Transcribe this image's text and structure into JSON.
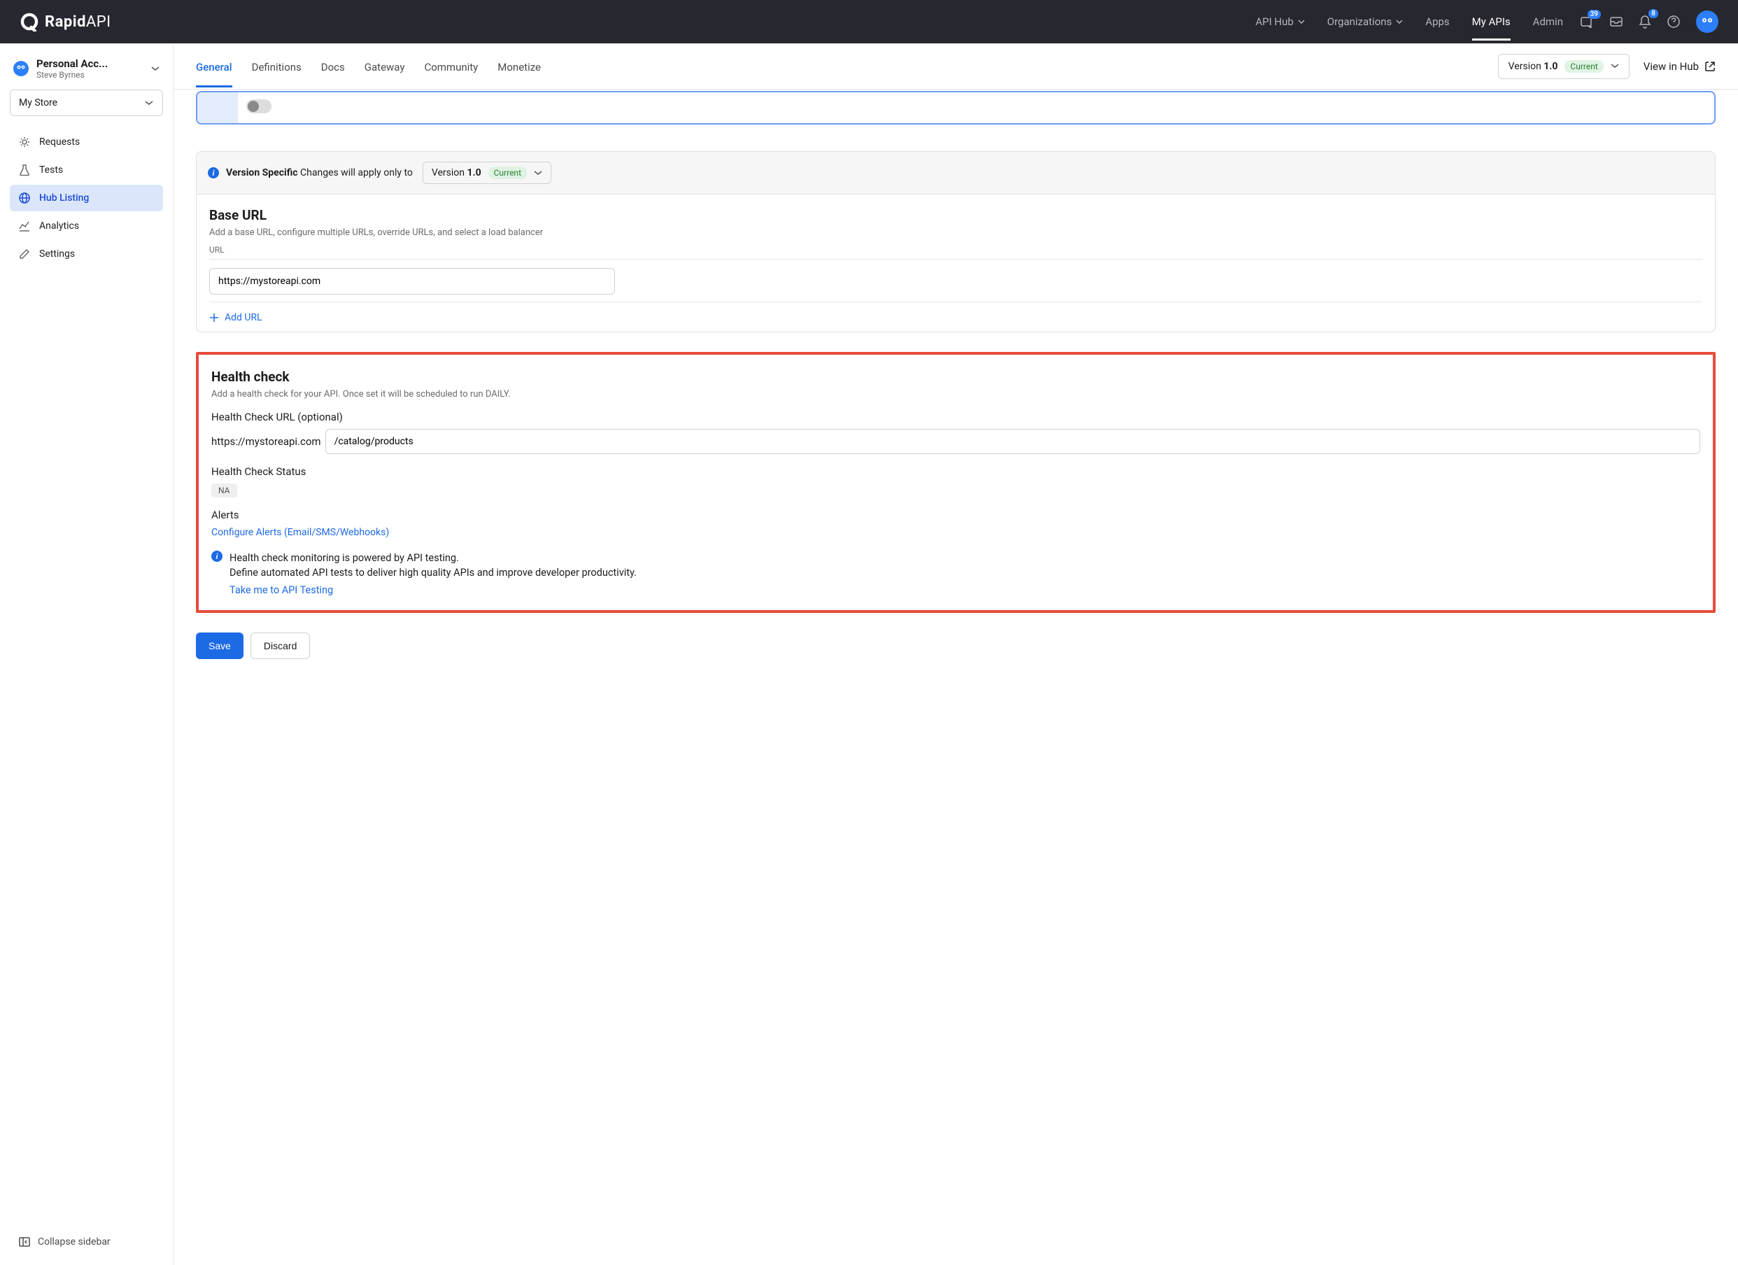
{
  "brand": {
    "name": "Rapid",
    "suffix": "API"
  },
  "topnav": {
    "items": [
      {
        "label": "API Hub",
        "caret": true
      },
      {
        "label": "Organizations",
        "caret": true
      },
      {
        "label": "Apps"
      },
      {
        "label": "My APIs",
        "active": true
      },
      {
        "label": "Admin"
      }
    ],
    "badge1": "39",
    "badge2": "8"
  },
  "account": {
    "title": "Personal Acc...",
    "subtitle": "Steve Byrnes"
  },
  "store_selector": "My Store",
  "sidebar": {
    "items": [
      {
        "label": "Requests"
      },
      {
        "label": "Tests"
      },
      {
        "label": "Hub Listing",
        "active": true
      },
      {
        "label": "Analytics"
      },
      {
        "label": "Settings"
      }
    ]
  },
  "collapse_label": "Collapse sidebar",
  "tabs": {
    "items": [
      {
        "label": "General",
        "active": true
      },
      {
        "label": "Definitions"
      },
      {
        "label": "Docs"
      },
      {
        "label": "Gateway"
      },
      {
        "label": "Community"
      },
      {
        "label": "Monetize"
      }
    ]
  },
  "version": {
    "prefix": "Version",
    "value": "1.0",
    "status": "Current"
  },
  "view_hub": "View in Hub",
  "version_banner": {
    "bold": "Version Specific",
    "rest": "Changes will apply only to"
  },
  "base_url": {
    "heading": "Base URL",
    "desc": "Add a base URL, configure multiple URLs, override URLs, and select a load balancer",
    "label": "URL",
    "value": "https://mystoreapi.com",
    "add": "Add URL"
  },
  "health": {
    "heading": "Health check",
    "desc": "Add a health check for your API. Once set it will be scheduled to run DAILY.",
    "url_label": "Health Check URL (optional)",
    "url_prefix": "https://mystoreapi.com",
    "url_value": "/catalog/products",
    "status_label": "Health Check Status",
    "status_value": "NA",
    "alerts_label": "Alerts",
    "alerts_link": "Configure Alerts (Email/SMS/Webhooks)",
    "info_line1": "Health check monitoring is powered by API testing.",
    "info_line2": "Define automated API tests to deliver high quality APIs and improve developer productivity.",
    "info_link": "Take me to API Testing"
  },
  "buttons": {
    "save": "Save",
    "discard": "Discard"
  }
}
